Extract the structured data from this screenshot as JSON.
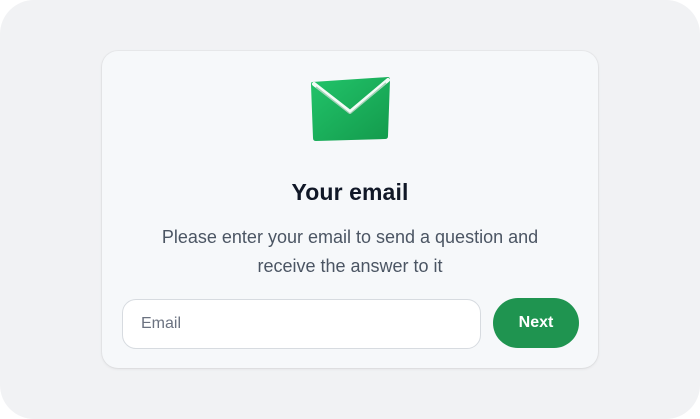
{
  "dialog": {
    "icon": "envelope-icon",
    "title": "Your email",
    "description": "Please enter your email to send a question and receive the answer to it",
    "email_field": {
      "placeholder": "Email",
      "value": ""
    },
    "next_label": "Next"
  },
  "colors": {
    "background": "#f1f2f4",
    "card": "#f6f8fa",
    "accent": "#1f9450",
    "envelope": "#19b05a",
    "title": "#111827",
    "body_text": "#4b5563"
  }
}
